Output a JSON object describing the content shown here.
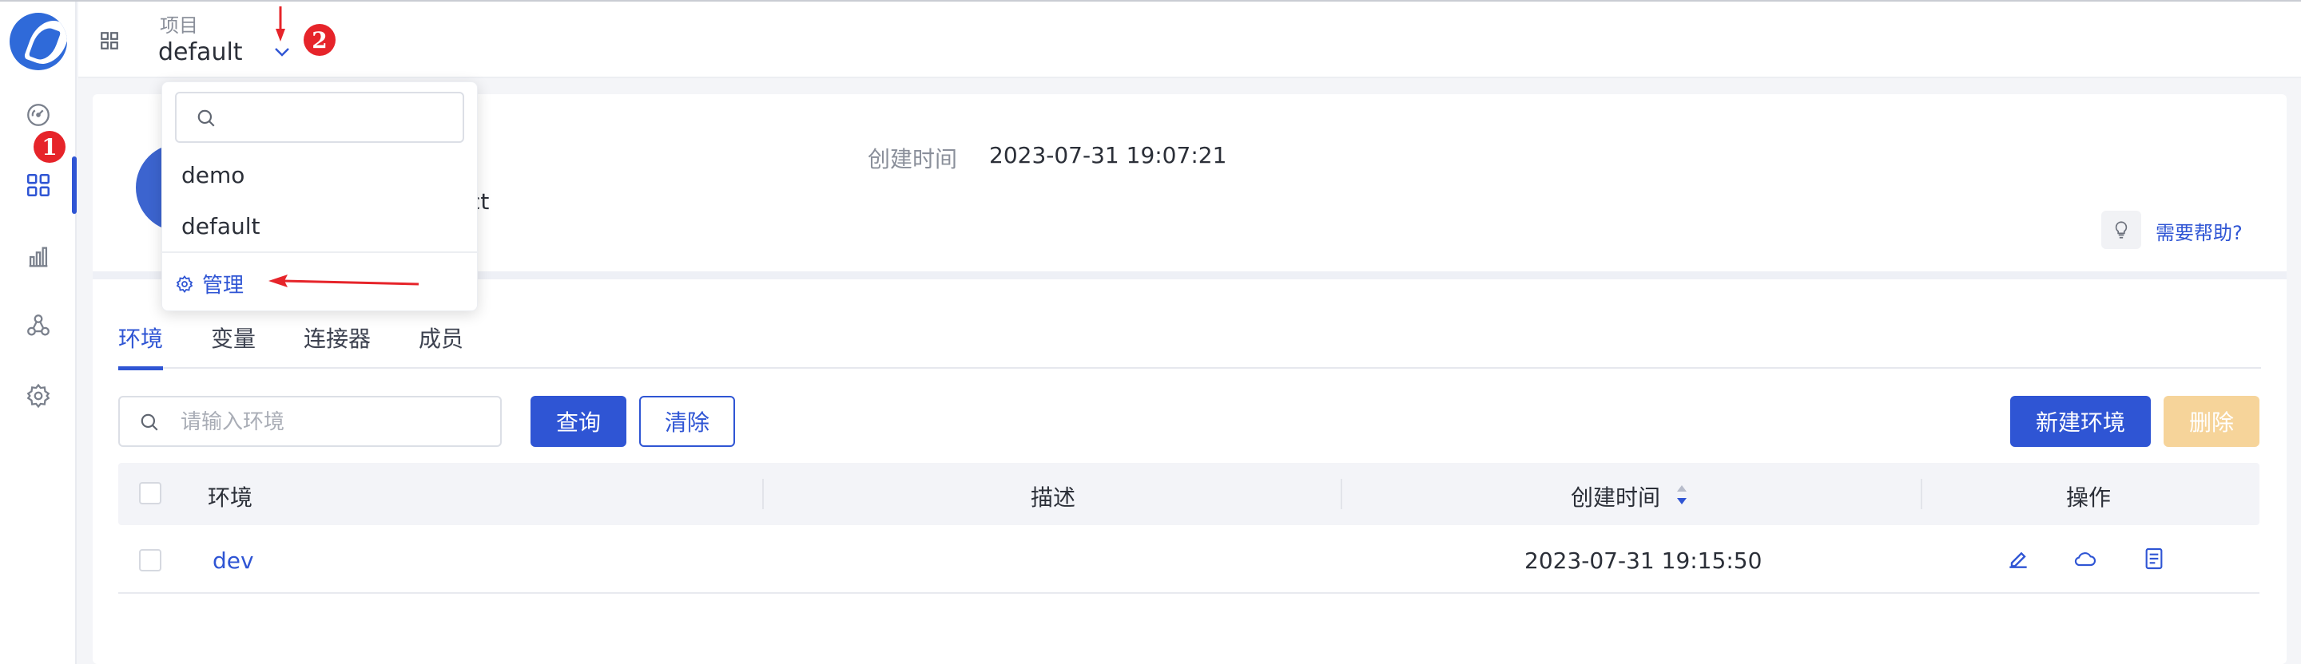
{
  "header": {
    "project_label": "项目",
    "project_value": "default"
  },
  "rail": {
    "items": [
      "dashboard-icon",
      "apps-icon",
      "chart-icon",
      "share-icon",
      "settings-icon"
    ],
    "active_index": 1
  },
  "annotations": {
    "badge_1": "1",
    "badge_2": "2"
  },
  "dropdown": {
    "search_placeholder": "",
    "items": [
      "demo",
      "default"
    ],
    "manage_label": "管理"
  },
  "project_info": {
    "description_tail": "ct",
    "created_label": "创建时间",
    "created_value": "2023-07-31 19:07:21",
    "help_label": "需要帮助?"
  },
  "tabs": [
    {
      "label": "环境",
      "active": true
    },
    {
      "label": "变量",
      "active": false
    },
    {
      "label": "连接器",
      "active": false
    },
    {
      "label": "成员",
      "active": false
    }
  ],
  "toolbar": {
    "search_placeholder": "请输入环境",
    "query_label": "查询",
    "clear_label": "清除",
    "new_label": "新建环境",
    "delete_label": "删除"
  },
  "table": {
    "headers": [
      "环境",
      "描述",
      "创建时间",
      "操作"
    ],
    "rows": [
      {
        "env": "dev",
        "description": "",
        "created": "2023-07-31 19:15:50"
      }
    ]
  },
  "colors": {
    "primary": "#2f55d4",
    "disabled": "#f6d49a",
    "annotation_red": "#e6242a"
  }
}
